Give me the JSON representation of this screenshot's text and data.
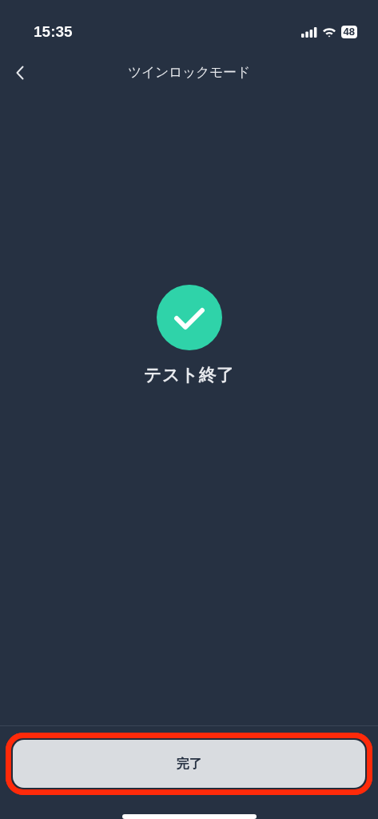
{
  "status_bar": {
    "time": "15:35",
    "battery": "48"
  },
  "nav": {
    "title": "ツインロックモード"
  },
  "result": {
    "message": "テスト終了"
  },
  "footer": {
    "button": {
      "label": "完了",
      "highlighted": true
    }
  }
}
